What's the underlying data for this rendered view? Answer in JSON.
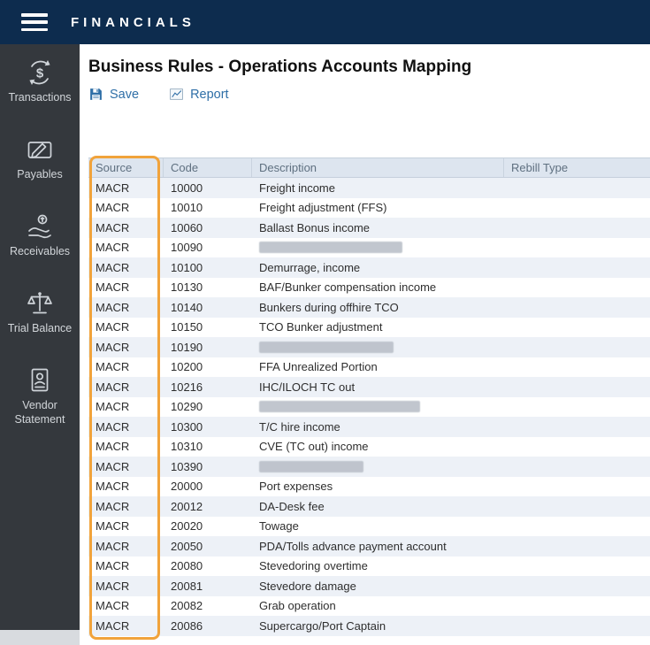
{
  "topbar": {
    "title": "FINANCIALS"
  },
  "sidebar": {
    "items": [
      {
        "label": "Transactions"
      },
      {
        "label": "Payables"
      },
      {
        "label": "Receivables"
      },
      {
        "label": "Trial Balance"
      },
      {
        "label": "Vendor Statement"
      }
    ]
  },
  "main": {
    "title": "Business Rules - Operations Accounts Mapping",
    "toolbar": {
      "save_label": "Save",
      "report_label": "Report"
    }
  },
  "table": {
    "columns": [
      "Source",
      "Code",
      "Description",
      "Rebill Type"
    ],
    "rows": [
      {
        "source": "MACR",
        "code": "10000",
        "description": "Freight income",
        "rebill": "",
        "redacted": false
      },
      {
        "source": "MACR",
        "code": "10010",
        "description": "Freight adjustment (FFS)",
        "rebill": "",
        "redacted": false
      },
      {
        "source": "MACR",
        "code": "10060",
        "description": "Ballast Bonus income",
        "rebill": "",
        "redacted": false
      },
      {
        "source": "MACR",
        "code": "10090",
        "description": "",
        "rebill": "",
        "redacted": true,
        "redacted_width": 162
      },
      {
        "source": "MACR",
        "code": "10100",
        "description": "Demurrage, income",
        "rebill": "",
        "redacted": false
      },
      {
        "source": "MACR",
        "code": "10130",
        "description": "BAF/Bunker compensation income",
        "rebill": "",
        "redacted": false
      },
      {
        "source": "MACR",
        "code": "10140",
        "description": "Bunkers during offhire TCO",
        "rebill": "",
        "redacted": false
      },
      {
        "source": "MACR",
        "code": "10150",
        "description": "TCO Bunker adjustment",
        "rebill": "",
        "redacted": false
      },
      {
        "source": "MACR",
        "code": "10190",
        "description": "",
        "rebill": "",
        "redacted": true,
        "redacted_width": 152
      },
      {
        "source": "MACR",
        "code": "10200",
        "description": "FFA Unrealized Portion",
        "rebill": "",
        "redacted": false
      },
      {
        "source": "MACR",
        "code": "10216",
        "description": "IHC/ILOCH TC out",
        "rebill": "",
        "redacted": false
      },
      {
        "source": "MACR",
        "code": "10290",
        "description": "",
        "rebill": "",
        "redacted": true,
        "redacted_width": 182
      },
      {
        "source": "MACR",
        "code": "10300",
        "description": "T/C hire income",
        "rebill": "",
        "redacted": false
      },
      {
        "source": "MACR",
        "code": "10310",
        "description": "CVE (TC out) income",
        "rebill": "",
        "redacted": false
      },
      {
        "source": "MACR",
        "code": "10390",
        "description": "",
        "rebill": "",
        "redacted": true,
        "redacted_width": 118
      },
      {
        "source": "MACR",
        "code": "20000",
        "description": "Port expenses",
        "rebill": "",
        "redacted": false
      },
      {
        "source": "MACR",
        "code": "20012",
        "description": "DA-Desk fee",
        "rebill": "",
        "redacted": false
      },
      {
        "source": "MACR",
        "code": "20020",
        "description": "Towage",
        "rebill": "",
        "redacted": false
      },
      {
        "source": "MACR",
        "code": "20050",
        "description": "PDA/Tolls advance payment account",
        "rebill": "",
        "redacted": false
      },
      {
        "source": "MACR",
        "code": "20080",
        "description": "Stevedoring overtime",
        "rebill": "",
        "redacted": false
      },
      {
        "source": "MACR",
        "code": "20081",
        "description": "Stevedore damage",
        "rebill": "",
        "redacted": false
      },
      {
        "source": "MACR",
        "code": "20082",
        "description": "Grab operation",
        "rebill": "",
        "redacted": false
      },
      {
        "source": "MACR",
        "code": "20086",
        "description": "Supercargo/Port Captain",
        "rebill": "",
        "redacted": false
      }
    ]
  },
  "colors": {
    "topbar": "#0d2c4e",
    "sidebar": "#34383d",
    "accent-blue": "#2f6fa7",
    "accent-orange": "#f1a33b"
  }
}
